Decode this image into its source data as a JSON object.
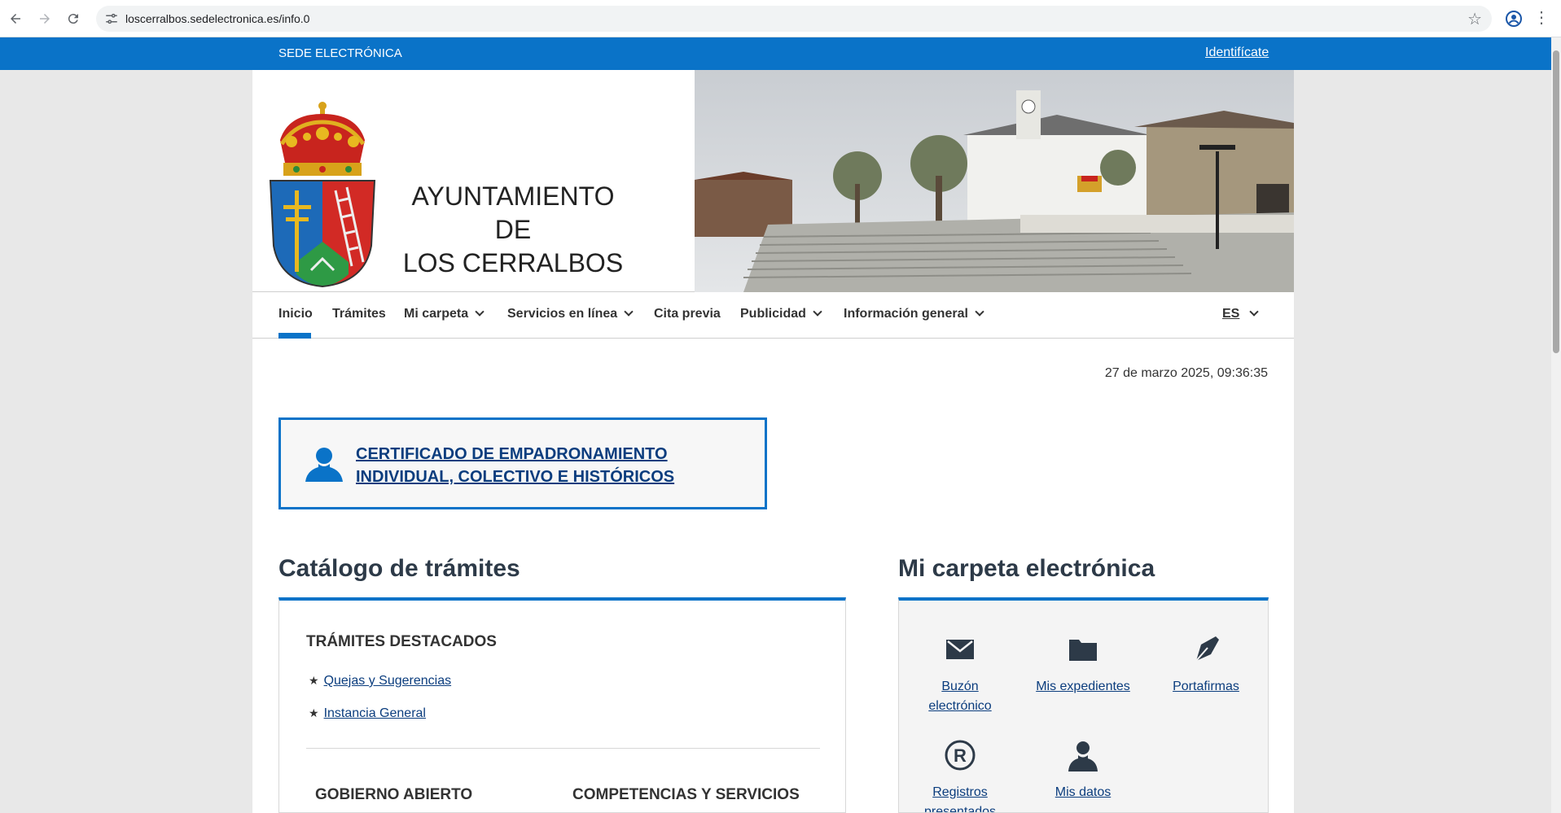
{
  "browser": {
    "url": "loscerralbos.sedelectronica.es/info.0"
  },
  "topbar": {
    "site_label": "SEDE ELECTRÓNICA",
    "login_link": "Identifícate"
  },
  "header": {
    "town_name_line1": "AYUNTAMIENTO DE",
    "town_name_line2": "LOS CERRALBOS"
  },
  "nav": {
    "items": [
      {
        "label": "Inicio",
        "active": true
      },
      {
        "label": "Trámites"
      },
      {
        "label": "Mi carpeta",
        "dropdown": true
      },
      {
        "label": "Servicios en línea",
        "dropdown": true
      },
      {
        "label": "Cita previa"
      },
      {
        "label": "Publicidad",
        "dropdown": true
      },
      {
        "label": "Información general",
        "dropdown": true
      }
    ],
    "language": "ES"
  },
  "datetime": "27 de marzo 2025, 09:36:35",
  "featured": {
    "line1": "CERTIFICADO DE EMPADRONAMIENTO",
    "line2": "INDIVIDUAL, COLECTIVO E HISTÓRICOS"
  },
  "catalog": {
    "title": "Catálogo de trámites",
    "highlighted_title": "TRÁMITES DESTACADOS",
    "highlighted_items": [
      "Quejas y Sugerencias",
      "Instancia General"
    ],
    "col1_title": "GOBIERNO ABIERTO",
    "col2_title": "COMPETENCIAS Y SERVICIOS"
  },
  "carpeta": {
    "title": "Mi carpeta electrónica",
    "items": [
      {
        "label_l1": "Buzón",
        "label_l2": "electrónico",
        "icon": "envelope-icon"
      },
      {
        "label_l1": "Mis expedientes",
        "label_l2": "",
        "icon": "folder-icon"
      },
      {
        "label_l1": "Portafirmas",
        "label_l2": "",
        "icon": "pen-nib-icon"
      },
      {
        "label_l1": "Registros",
        "label_l2": "presentados",
        "icon": "registered-icon"
      },
      {
        "label_l1": "Mis datos",
        "label_l2": "",
        "icon": "user-icon"
      }
    ]
  },
  "colors": {
    "brand_blue": "#0a73c8",
    "link_navy": "#0b3d7e"
  }
}
